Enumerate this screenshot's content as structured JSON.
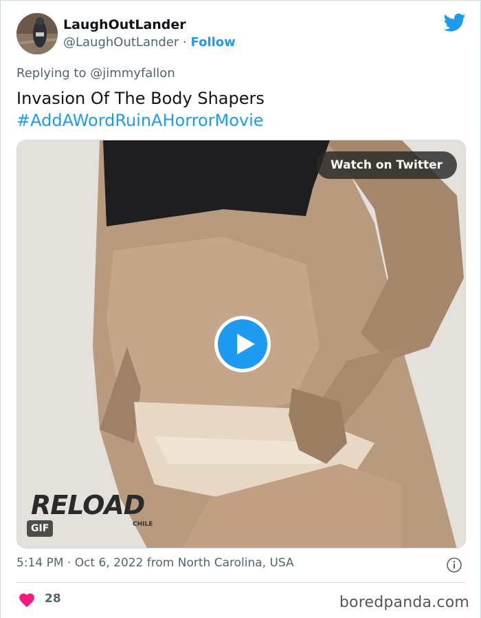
{
  "colors": {
    "accent": "#1d9bf0",
    "like": "#f91880",
    "secondary_text": "#536471"
  },
  "author": {
    "display_name": "LaughOutLander",
    "handle": "@LaughOutLander",
    "separator": "·",
    "follow_label": "Follow",
    "avatar_icon": "user-avatar"
  },
  "reply": {
    "prefix": "Replying to",
    "mention": "@jimmyfallon"
  },
  "tweet": {
    "text": "Invasion Of The Body Shapers",
    "hashtag": "#AddAWordRuinAHorrorMovie"
  },
  "media": {
    "watch_label": "Watch on Twitter",
    "gif_badge": "GIF",
    "logo_text": "RELOAD",
    "logo_sub": "CHILE"
  },
  "meta": {
    "timestamp": "5:14 PM · Oct 6, 2022 from North Carolina, USA"
  },
  "engagement": {
    "likes": "28"
  },
  "watermark": "boredpanda.com"
}
